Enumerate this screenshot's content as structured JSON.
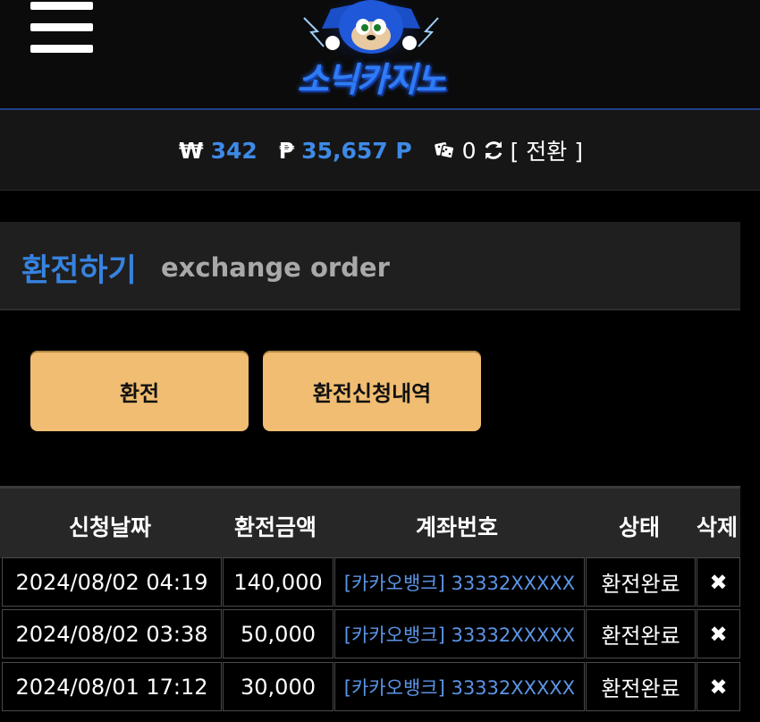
{
  "header": {
    "logo_text": "소닉카지노"
  },
  "balance": {
    "won_symbol": "₩",
    "won_value": "342",
    "point_symbol": "₱",
    "point_value": "35,657 P",
    "dice_count": "0",
    "convert_label": "[ 전환 ]"
  },
  "section": {
    "title_ko": "환전하기",
    "title_en": "exchange order"
  },
  "buttons": {
    "exchange": "환전",
    "history": "환전신청내역"
  },
  "table": {
    "headers": {
      "date": "신청날짜",
      "amount": "환전금액",
      "account": "계좌번호",
      "status": "상태",
      "delete": "삭제"
    },
    "rows": [
      {
        "date": "2024/08/02 04:19",
        "amount": "140,000",
        "account": "[카카오뱅크] 33332XXXXX",
        "status": "환전완료",
        "delete": "✖"
      },
      {
        "date": "2024/08/02 03:38",
        "amount": "50,000",
        "account": "[카카오뱅크] 33332XXXXX",
        "status": "환전완료",
        "delete": "✖"
      },
      {
        "date": "2024/08/01 17:12",
        "amount": "30,000",
        "account": "[카카오뱅크] 33332XXXXX",
        "status": "환전완료",
        "delete": "✖"
      }
    ]
  },
  "colors": {
    "accent_blue": "#3e8ae6",
    "button_gold": "#f0bd72"
  }
}
